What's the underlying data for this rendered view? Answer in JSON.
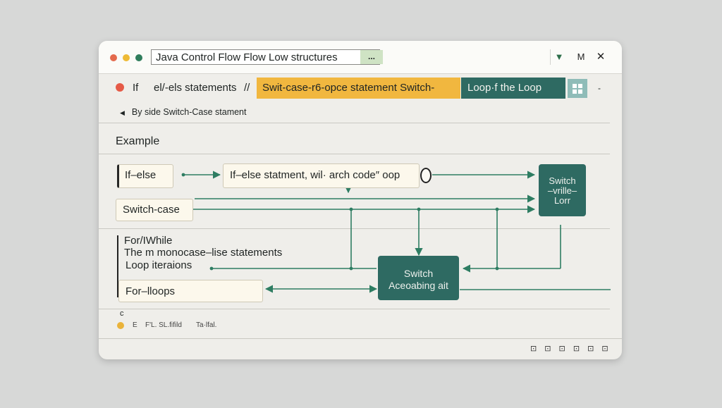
{
  "window": {
    "title": "Java Control Flow Flow Low structures",
    "title_more": "...",
    "controls": {
      "chevron": "▼",
      "minimize": "M",
      "close": "✕"
    }
  },
  "toolbar": {
    "tab_if": "If",
    "tab_else": "el/-els statements",
    "separator": "//",
    "tab_switch": "Swit-case-r6-opce statement  Switch-",
    "tab_loop": "Loop·f the Loop",
    "more": "-",
    "grid_icon": "grid-icon"
  },
  "breadcrumb": {
    "caret": "◀",
    "text": "By side  Switch-Case stament"
  },
  "section": {
    "heading": "Example"
  },
  "nodes": {
    "if_else": "If–else",
    "switch_case": "Switch-case",
    "statement_box": "If–else statment,  wil· arch  code″ oop",
    "switch_loop": [
      "Switch",
      "–vrille–",
      "Lorr"
    ],
    "for_while_title": "For/IWhile",
    "for_while_line1": "The m monocase–lise statements",
    "for_while_line2": "Loop iteraions",
    "for_loops": "For–lloops",
    "switch_center": [
      "Switch",
      "Aceoabing ait"
    ]
  },
  "footer": {
    "c_label": "c",
    "e_label": "E",
    "text1": "F'L.  SL.fifild",
    "text2": "Ta·lfal.",
    "status_icons": "⊡ ⊡ ⊡ ⊡ ⊡ ⊡"
  },
  "colors": {
    "teal": "#2e6a62",
    "yellow": "#f1b73f",
    "wire": "#2e7d62",
    "panel": "#efeeea"
  }
}
